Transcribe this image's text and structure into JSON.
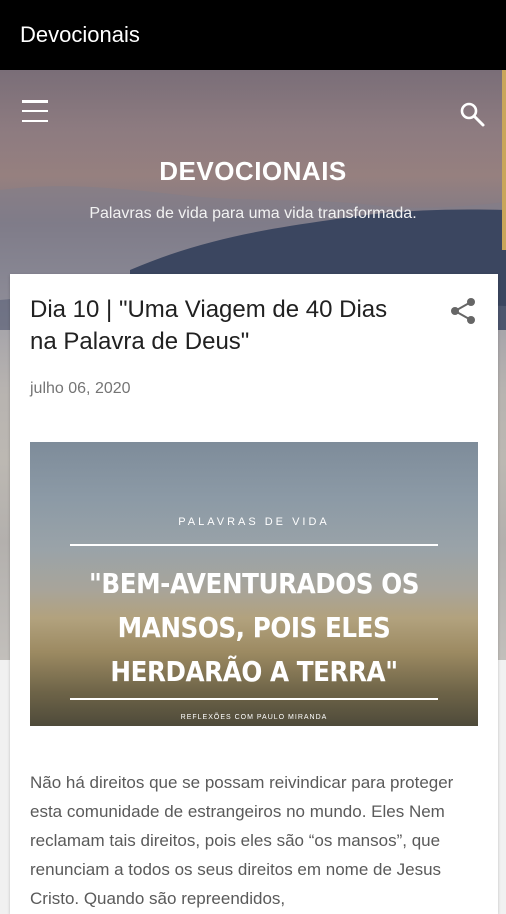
{
  "appbar": {
    "title": "Devocionais"
  },
  "header": {
    "site_title": "DEVOCIONAIS",
    "description": "Palavras de vida para uma vida transformada.",
    "menu_icon": "menu-icon",
    "search_icon": "search-icon"
  },
  "post": {
    "title": "Dia 10 | \"Uma Viagem de 40 Dias na Palavra de Deus\"",
    "date": "julho 06, 2020",
    "share_icon": "share-icon",
    "image": {
      "kicker": "PALAVRAS DE VIDA",
      "quote": "\"BEM-AVENTURADOS OS MANSOS, POIS ELES HERDARÃO A TERRA\"",
      "credit": "REFLEXÕES COM PAULO MIRANDA"
    },
    "body": "Não há direitos que se possam reivindicar para proteger esta comunidade de estrangeiros no mundo. Eles Nem reclamam tais direitos, pois eles são “os mansos”, que renunciam a todos os seus direitos em nome de Jesus Cristo. Quando são repreendidos,"
  }
}
